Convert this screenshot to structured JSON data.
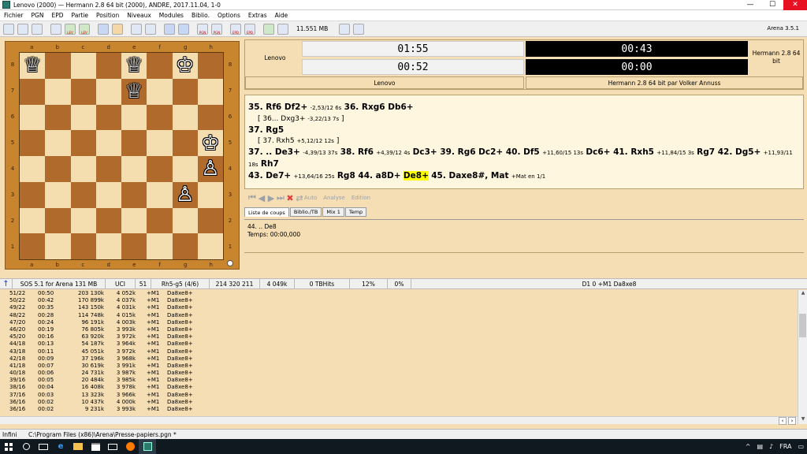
{
  "window": {
    "title": "Lenovo (2000)  —  Hermann 2.8 64 bit (2000),  ANDRE,  2017.11.04,  1-0",
    "minimize": "—",
    "maximize": "☐",
    "close": "✕"
  },
  "menu": [
    "Fichier",
    "PGN",
    "EPD",
    "Partie",
    "Position",
    "Niveaux",
    "Modules",
    "Biblio.",
    "Options",
    "Extras",
    "Aide"
  ],
  "toolbar": {
    "lev1": "LEV",
    "lev2": "LEV",
    "pgn1": "PGN",
    "pgn2": "PGN",
    "epd1": "EPD",
    "epd2": "EPD",
    "memory": "11.551 MB",
    "version": "Arena 3.5.1"
  },
  "board": {
    "files": [
      "a",
      "b",
      "c",
      "d",
      "e",
      "f",
      "g",
      "h"
    ],
    "ranks": [
      "8",
      "7",
      "6",
      "5",
      "4",
      "3",
      "2",
      "1"
    ],
    "squares": [
      [
        "♕",
        "",
        "",
        "",
        "♕",
        "",
        "♔",
        ""
      ],
      [
        "",
        "",
        "",
        "",
        "♕",
        "",
        "",
        ""
      ],
      [
        "",
        "",
        "",
        "",
        "",
        "",
        "",
        ""
      ],
      [
        "",
        "",
        "",
        "",
        "",
        "",
        "",
        "♔"
      ],
      [
        "",
        "",
        "",
        "",
        "",
        "",
        "",
        "♙"
      ],
      [
        "",
        "",
        "",
        "",
        "",
        "",
        "♙",
        ""
      ],
      [
        "",
        "",
        "",
        "",
        "",
        "",
        "",
        ""
      ],
      [
        "",
        "",
        "",
        "",
        "",
        "",
        "",
        ""
      ]
    ]
  },
  "clocks": {
    "white_name": "Lenovo",
    "black_name": "Hermann 2.8 64 bit",
    "white_time1": "01:55",
    "white_time2": "00:52",
    "black_time1": "00:43",
    "black_time2": "00:00",
    "white_sub": "Lenovo",
    "black_sub": "Hermann 2.8 64 bit par Volker Annuss"
  },
  "notation": {
    "l1a": "35. Rf6 Df2+",
    "l1c": "-2,53/12 6s",
    "l1b": "36. Rxg6 Db6+",
    "l2a": "[ 36... Dxg3+",
    "l2c": "-3,22/13 7s",
    "l2b": "]",
    "l3": "37. Rg5",
    "l4a": "[ 37. Rxh5",
    "l4c": "+5,12/12 12s",
    "l4b": "]",
    "m1": "37. .. De3+",
    "c1": "-4,39/13 37s",
    "m2": "38. Rf6",
    "c2": "+4,39/12 4s",
    "m3": "Dc3+ 39. Rg6 Dc2+ 40. Df5",
    "c3": "+11,60/15 13s",
    "m4": "Dc6+ 41. Rxh5",
    "c4": "+11,84/15 3s",
    "m5": "Rg7 42. Dg5+",
    "c5": "+11,93/11 18s",
    "m6": "Rh7",
    "m7": "43. De7+",
    "c7": "+13,64/16 25s",
    "m8": "Rg8 44. a8D+",
    "m9": "De8+",
    "m10": "45. Daxe8#, Mat",
    "c10": "+Mat en 1/1"
  },
  "nav": {
    "auto": "Auto",
    "analyse": "Analyse",
    "edition": "Edition"
  },
  "tabs": [
    "Liste de coups",
    "Biblio./TB",
    "Mix 1",
    "Temp"
  ],
  "info": {
    "line1": "44. .. De8",
    "line2": "Temps: 00:00,000"
  },
  "engine": {
    "name": "SOS 5.1 for Arena  131 MB",
    "uci": "UCI",
    "depth": "51",
    "move": "Rh5-g5 (4/6)",
    "nodes": "214 320 211",
    "nps": "4 049k",
    "tbhits": "0 TBHits",
    "pct1": "12%",
    "pct2": "0%",
    "best": "D1  0  +M1  Da8xe8"
  },
  "analysis": [
    [
      "51/22",
      "00:50",
      "203 130k",
      "4 052k",
      "+M1",
      "Da8xe8+"
    ],
    [
      "50/22",
      "00:42",
      "170 899k",
      "4 037k",
      "+M1",
      "Da8xe8+"
    ],
    [
      "49/22",
      "00:35",
      "143 150k",
      "4 031k",
      "+M1",
      "Da8xe8+"
    ],
    [
      "48/22",
      "00:28",
      "114 748k",
      "4 015k",
      "+M1",
      "Da8xe8+"
    ],
    [
      "47/20",
      "00:24",
      "96 191k",
      "4 003k",
      "+M1",
      "Da8xe8+"
    ],
    [
      "46/20",
      "00:19",
      "76 805k",
      "3 993k",
      "+M1",
      "Da8xe8+"
    ],
    [
      "45/20",
      "00:16",
      "63 920k",
      "3 972k",
      "+M1",
      "Da8xe8+"
    ],
    [
      "44/18",
      "00:13",
      "54 187k",
      "3 964k",
      "+M1",
      "Da8xe8+"
    ],
    [
      "43/18",
      "00:11",
      "45 051k",
      "3 972k",
      "+M1",
      "Da8xe8+"
    ],
    [
      "42/18",
      "00:09",
      "37 196k",
      "3 968k",
      "+M1",
      "Da8xe8+"
    ],
    [
      "41/18",
      "00:07",
      "30 619k",
      "3 991k",
      "+M1",
      "Da8xe8+"
    ],
    [
      "40/18",
      "00:06",
      "24 731k",
      "3 987k",
      "+M1",
      "Da8xe8+"
    ],
    [
      "39/16",
      "00:05",
      "20 484k",
      "3 985k",
      "+M1",
      "Da8xe8+"
    ],
    [
      "38/16",
      "00:04",
      "16 408k",
      "3 978k",
      "+M1",
      "Da8xe8+"
    ],
    [
      "37/16",
      "00:03",
      "13 323k",
      "3 966k",
      "+M1",
      "Da8xe8+"
    ],
    [
      "36/16",
      "00:02",
      "10 437k",
      "4 000k",
      "+M1",
      "Da8xe8+"
    ],
    [
      "36/16",
      "00:02",
      "9 231k",
      "3 993k",
      "+M1",
      "Da8xe8+"
    ]
  ],
  "status": {
    "mode": "Infini",
    "path": "C:\\Program Files (x86)\\Arena\\Presse-papiers.pgn *"
  },
  "tray": {
    "caret": "^",
    "lang": "FRA",
    "chat": "▭"
  }
}
